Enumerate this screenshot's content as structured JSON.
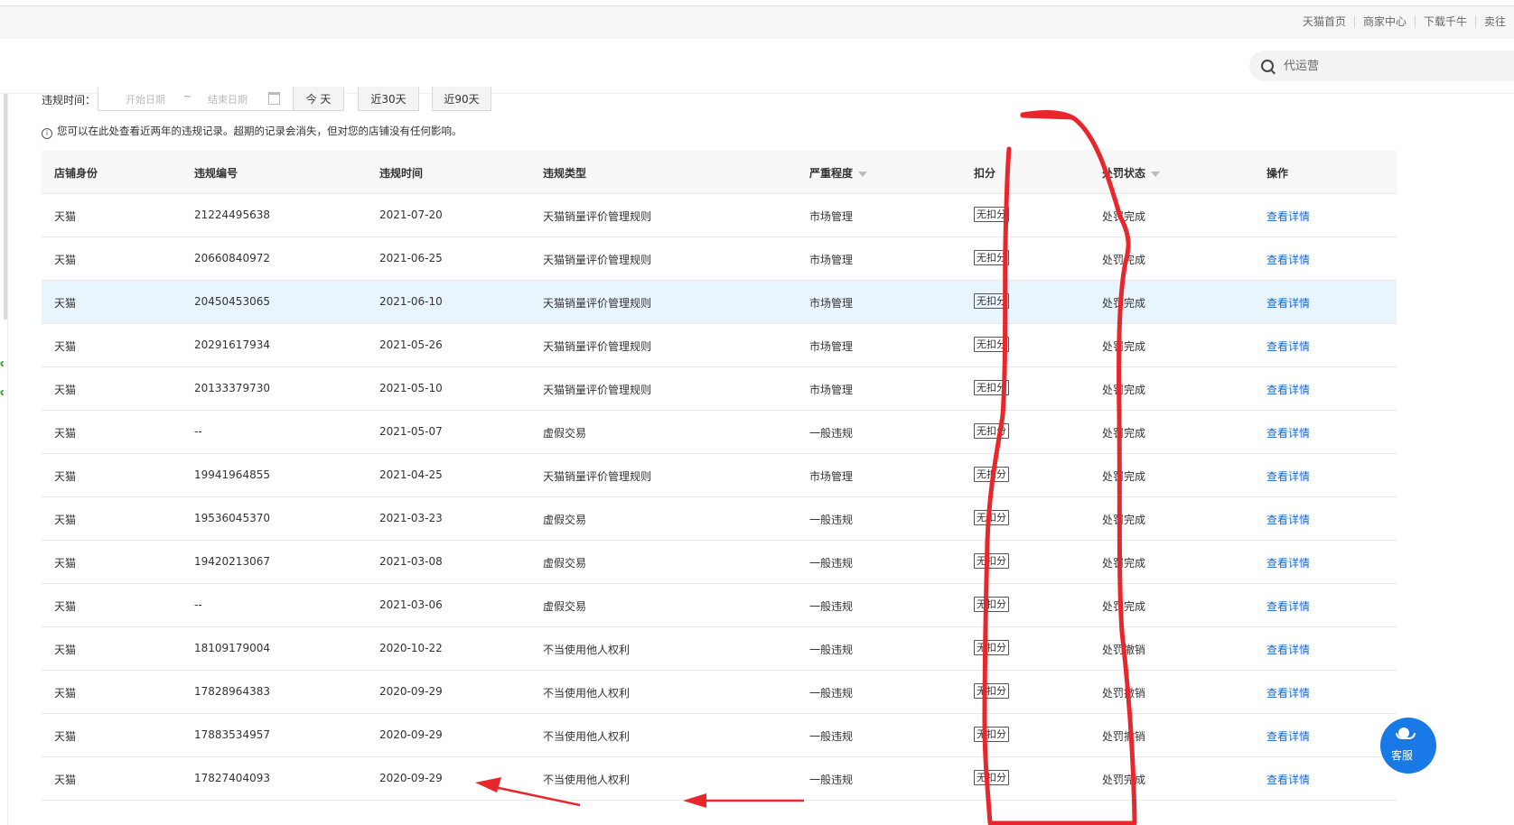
{
  "topnav": {
    "links": [
      "天猫首页",
      "商家中心",
      "下载千牛",
      "卖往"
    ]
  },
  "search": {
    "placeholder": "代运营"
  },
  "filter": {
    "label": "违规时间：",
    "start_placeholder": "开始日期",
    "separator": "~",
    "end_placeholder": "结束日期",
    "quick_buttons": [
      "今 天",
      "近30天",
      "近90天"
    ]
  },
  "notice": "您可以在此处查看近两年的违规记录。超期的记录会消失，但对您的店铺没有任何影响。",
  "table": {
    "headers": [
      "店铺身份",
      "违规编号",
      "违规时间",
      "违规类型",
      "严重程度",
      "扣分",
      "处罚状态",
      "操作"
    ],
    "rows": [
      [
        "天猫",
        "21224495638",
        "2021-07-20",
        "天猫销量评价管理规则",
        "市场管理",
        "无扣分",
        "处罚完成",
        "查看详情"
      ],
      [
        "天猫",
        "20660840972",
        "2021-06-25",
        "天猫销量评价管理规则",
        "市场管理",
        "无扣分",
        "处罚完成",
        "查看详情"
      ],
      [
        "天猫",
        "20450453065",
        "2021-06-10",
        "天猫销量评价管理规则",
        "市场管理",
        "无扣分",
        "处罚完成",
        "查看详情"
      ],
      [
        "天猫",
        "20291617934",
        "2021-05-26",
        "天猫销量评价管理规则",
        "市场管理",
        "无扣分",
        "处罚完成",
        "查看详情"
      ],
      [
        "天猫",
        "20133379730",
        "2021-05-10",
        "天猫销量评价管理规则",
        "市场管理",
        "无扣分",
        "处罚完成",
        "查看详情"
      ],
      [
        "天猫",
        "--",
        "2021-05-07",
        "虚假交易",
        "一般违规",
        "无扣分",
        "处罚完成",
        "查看详情"
      ],
      [
        "天猫",
        "19941964855",
        "2021-04-25",
        "天猫销量评价管理规则",
        "市场管理",
        "无扣分",
        "处罚完成",
        "查看详情"
      ],
      [
        "天猫",
        "19536045370",
        "2021-03-23",
        "虚假交易",
        "一般违规",
        "无扣分",
        "处罚完成",
        "查看详情"
      ],
      [
        "天猫",
        "19420213067",
        "2021-03-08",
        "虚假交易",
        "一般违规",
        "无扣分",
        "处罚完成",
        "查看详情"
      ],
      [
        "天猫",
        "--",
        "2021-03-06",
        "虚假交易",
        "一般违规",
        "无扣分",
        "处罚完成",
        "查看详情"
      ],
      [
        "天猫",
        "18109179004",
        "2020-10-22",
        "不当使用他人权利",
        "一般违规",
        "无扣分",
        "处罚撤销",
        "查看详情"
      ],
      [
        "天猫",
        "17828964383",
        "2020-09-29",
        "不当使用他人权利",
        "一般违规",
        "无扣分",
        "处罚撤销",
        "查看详情"
      ],
      [
        "天猫",
        "17883534957",
        "2020-09-29",
        "不当使用他人权利",
        "一般违规",
        "无扣分",
        "处罚撤销",
        "查看详情"
      ],
      [
        "天猫",
        "17827404093",
        "2020-09-29",
        "不当使用他人权利",
        "一般违规",
        "无扣分",
        "处罚完成",
        "查看详情"
      ]
    ],
    "highlighted_row": 2
  },
  "support": {
    "label": "客服"
  },
  "colors": {
    "link": "#1565d8",
    "annotation": "#e8262b",
    "highlight_row": "#e9f5fd",
    "support": "#1979e6"
  }
}
